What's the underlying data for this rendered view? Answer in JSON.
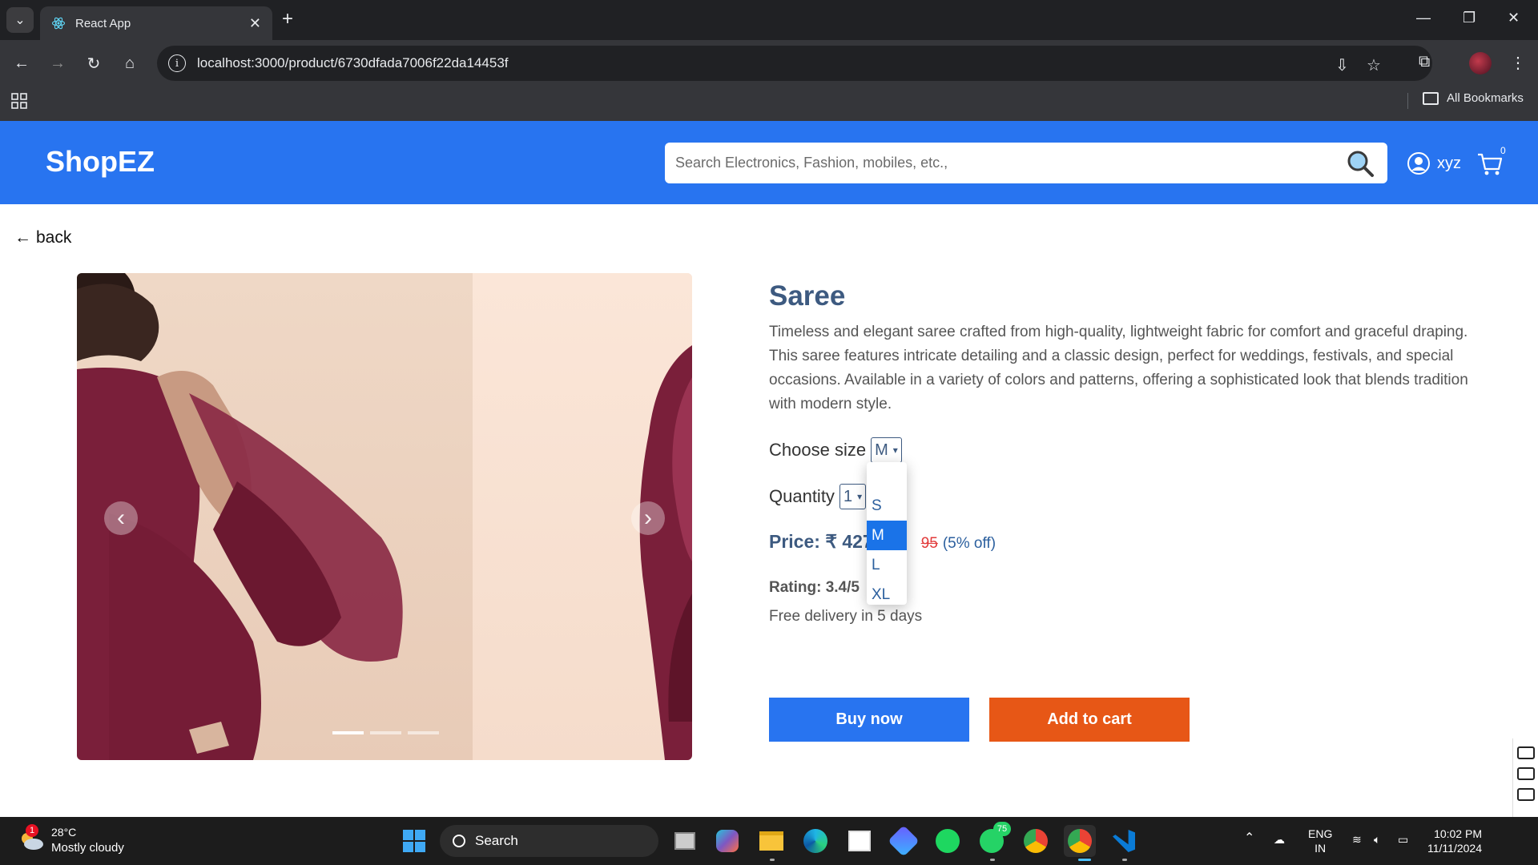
{
  "browser": {
    "tab_title": "React App",
    "url": "localhost:3000/product/6730dfada7006f22da14453f",
    "bookmarks_label": "All Bookmarks"
  },
  "header": {
    "brand": "ShopEZ",
    "search_placeholder": "Search Electronics, Fashion, mobiles, etc.,",
    "username": "xyz",
    "cart_count": "0",
    "accent_color": "#2874f0"
  },
  "page": {
    "back_label": "back",
    "product": {
      "title": "Saree",
      "description": "Timeless and elegant saree crafted from high-quality, lightweight fabric for comfort and graceful draping. This saree features intricate detailing and a classic design, perfect for weddings, festivals, and special occasions. Available in a variety of colors and patterns, offering a sophisticated look that blends tradition with modern style.",
      "size_label": "Choose size",
      "size_selected": "M",
      "size_options": [
        "S",
        "M",
        "L",
        "XL"
      ],
      "quantity_label": "Quantity",
      "quantity_selected": "1",
      "price_text": "Price: ₹ 427",
      "old_price_visible": "95",
      "discount": "(5% off)",
      "rating": "Rating: 3.4/5",
      "delivery": "Free delivery in 5 days"
    },
    "carousel": {
      "slide_count": 3,
      "active_index": 0
    },
    "actions": {
      "buy_now": "Buy now",
      "add_to_cart": "Add to cart",
      "buy_color": "#2874f0",
      "cart_color": "#e75716"
    }
  },
  "taskbar": {
    "weather_badge": "1",
    "weather_temp": "28°C",
    "weather_condition": "Mostly cloudy",
    "search_label": "Search",
    "whatsapp_badge": "75",
    "language_line1": "ENG",
    "language_line2": "IN",
    "time": "10:02 PM",
    "date": "11/11/2024"
  }
}
